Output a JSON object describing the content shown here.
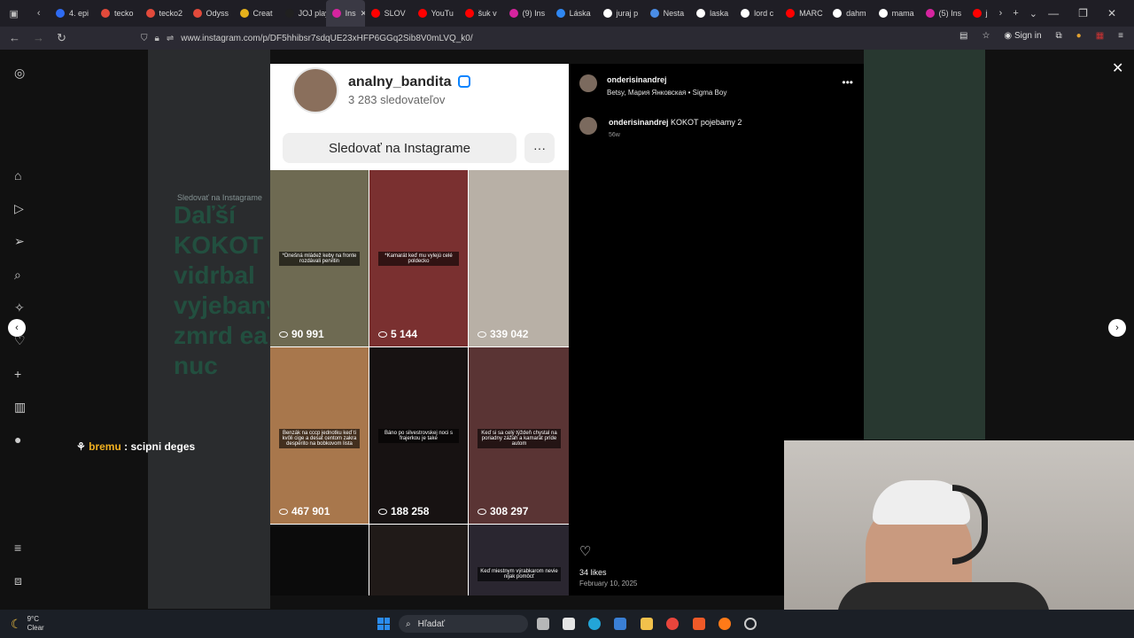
{
  "browser": {
    "tabs": [
      {
        "label": "4. epi",
        "color": "#2e6bf2"
      },
      {
        "label": "tecko",
        "color": "#e24a3b"
      },
      {
        "label": "tecko2",
        "color": "#e24a3b"
      },
      {
        "label": "Odyss",
        "color": "#e24a3b"
      },
      {
        "label": "Creat",
        "color": "#e6b21c"
      },
      {
        "label": "JOJ play",
        "color": "#202020"
      },
      {
        "label": "Ins",
        "color": "#d6249f",
        "active": true
      },
      {
        "label": "SLOV",
        "color": "#ff0000"
      },
      {
        "label": "YouTu",
        "color": "#ff0000"
      },
      {
        "label": "šuk v",
        "color": "#ff0000"
      },
      {
        "label": "(9) Ins",
        "color": "#d6249f"
      },
      {
        "label": "Láska",
        "color": "#2f87f2"
      },
      {
        "label": "juraj p",
        "color": "#ffffff"
      },
      {
        "label": "Nesta",
        "color": "#4a8de6"
      },
      {
        "label": "laska",
        "color": "#ffffff"
      },
      {
        "label": "lord c",
        "color": "#ffffff"
      },
      {
        "label": "MARC",
        "color": "#ff0000"
      },
      {
        "label": "dahm",
        "color": "#ffffff"
      },
      {
        "label": "mama",
        "color": "#ffffff"
      },
      {
        "label": "(5) Ins",
        "color": "#d6249f"
      },
      {
        "label": "j",
        "color": "#ff0000"
      }
    ],
    "url": "www.instagram.com/p/DF5hhibsr7sdqUE23xHFP6GGq2Sib8V0mLVQ_k0/",
    "sign_in": "Sign in"
  },
  "profile": {
    "username": "analny_bandita",
    "followers": "3 283 sledovateľov",
    "follow_button": "Sledovať na Instagrame",
    "more": "···"
  },
  "grid": [
    {
      "views": "90 991",
      "caption": "*Dnešná mládež keby na fronte rozdávali pervitin",
      "bg": "#6e6a52"
    },
    {
      "views": "5 144",
      "caption": "*Kamarát keď mu vylejú celé poldecko",
      "bg": "#7a3030"
    },
    {
      "views": "339 042",
      "caption": "",
      "bg": "#b8b0a6"
    },
    {
      "views": "467 901",
      "caption": "Benzák na cccp jednotku keď ti kvôli cige a desat centom zakra desperito na bobkovom lista",
      "bg": "#a8774c"
    },
    {
      "views": "188 258",
      "caption": "Báno po silvestrovskej noci s frajerkou je take",
      "bg": "#171212"
    },
    {
      "views": "308 297",
      "caption": "Keď si sa celý týždeň chystal na poriadny zážah a kamarát príde autom",
      "bg": "#5a3434"
    },
    {
      "views": "",
      "caption": "",
      "bg": "#0b0b0b"
    },
    {
      "views": "",
      "caption": "",
      "bg": "#201a18"
    },
    {
      "views": "",
      "caption": "Keď miestnym výrabkarom nevie nijak pomôcť",
      "bg": "#2a2630"
    }
  ],
  "post": {
    "author": "onderisinandrej",
    "audio": "Betsy, Мария Янковская • Sigma Boy",
    "comment_user": "onderisinandrej",
    "comment_text": "KOKOT pojebamy 2",
    "time_ago": "56w",
    "likes": "34 likes",
    "date": "February 10, 2025"
  },
  "background_text": {
    "follow": "Sledovať na Instagrame",
    "overlay": "Daľší KOKOT vidrbal vyjebany zmrd ea nuc"
  },
  "chat": {
    "user": "bremu",
    "message": ": scipni deges"
  },
  "taskbar": {
    "temp": "9°C",
    "weather": "Clear",
    "search": "Hľadať"
  },
  "rail_icons": [
    "instagram-icon",
    "home-icon",
    "reels-icon",
    "messages-icon",
    "search-icon",
    "explore-icon",
    "notifications-icon",
    "create-icon",
    "insights-icon",
    "profile-icon",
    "menu-icon",
    "meta-icon"
  ]
}
